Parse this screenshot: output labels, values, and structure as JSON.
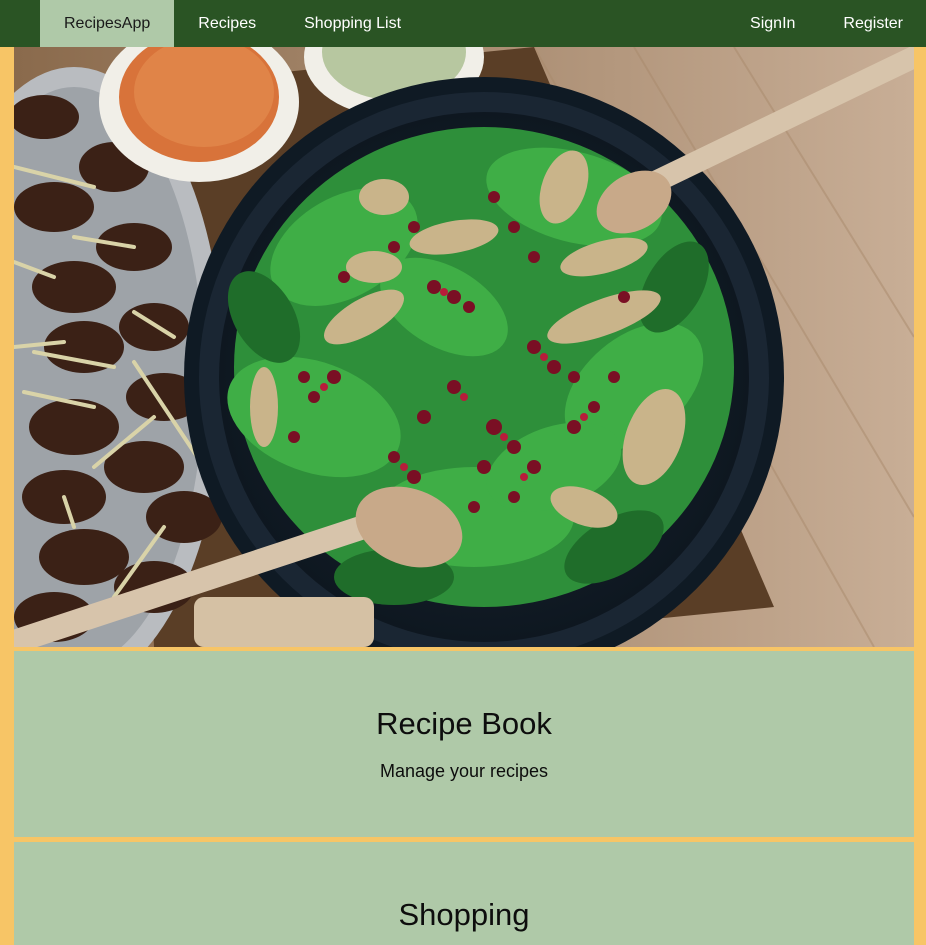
{
  "nav": {
    "brand": "RecipesApp",
    "links": [
      "Recipes",
      "Shopping List"
    ],
    "auth": [
      "SignIn",
      "Register"
    ]
  },
  "hero": {
    "image": "salad-bowl-photo"
  },
  "cards": {
    "recipes": {
      "title": "Recipe Book",
      "subtitle": "Manage your recipes"
    },
    "shopping": {
      "title": "Shopping"
    }
  },
  "colors": {
    "nav_bg": "#2a5424",
    "brand_bg": "#afc9a8",
    "card_bg": "#afc9a8",
    "page_bg": "#f7c566"
  }
}
